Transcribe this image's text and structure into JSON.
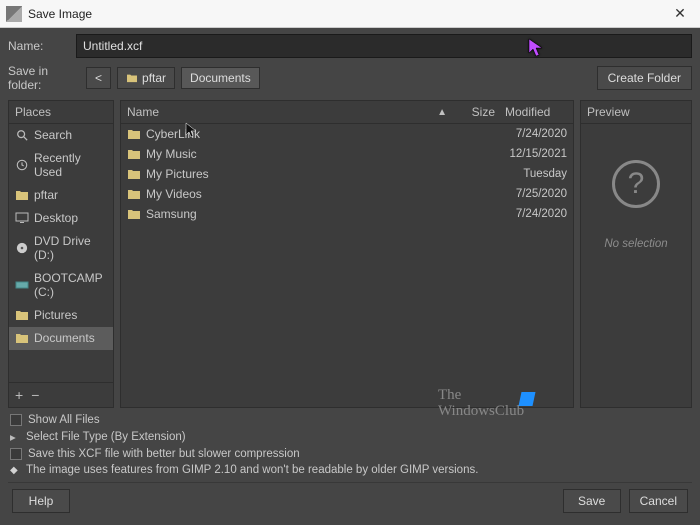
{
  "window": {
    "title": "Save Image"
  },
  "name_row": {
    "label": "Name:",
    "value": "Untitled.xcf"
  },
  "folder_row": {
    "label": "Save in folder:",
    "back": "<",
    "segments": [
      {
        "icon": "folder",
        "label": "pftar"
      },
      {
        "label": "Documents"
      }
    ],
    "create_folder": "Create Folder"
  },
  "places": {
    "header": "Places",
    "items": [
      {
        "icon": "search",
        "label": "Search"
      },
      {
        "icon": "recent",
        "label": "Recently Used"
      },
      {
        "icon": "user",
        "label": "pftar"
      },
      {
        "icon": "desktop",
        "label": "Desktop"
      },
      {
        "icon": "dvd",
        "label": "DVD Drive (D:)"
      },
      {
        "icon": "drive",
        "label": "BOOTCAMP (C:)"
      },
      {
        "icon": "folder",
        "label": "Pictures"
      },
      {
        "icon": "folder",
        "label": "Documents",
        "selected": true
      }
    ],
    "add": "+",
    "remove": "−"
  },
  "files": {
    "columns": {
      "name": "Name",
      "size": "Size",
      "modified": "Modified"
    },
    "rows": [
      {
        "name": "CyberLink",
        "modified": "7/24/2020"
      },
      {
        "name": "My Music",
        "modified": "12/15/2021"
      },
      {
        "name": "My Pictures",
        "modified": "Tuesday"
      },
      {
        "name": "My Videos",
        "modified": "7/25/2020"
      },
      {
        "name": "Samsung",
        "modified": "7/24/2020"
      }
    ]
  },
  "preview": {
    "header": "Preview",
    "empty": "No selection"
  },
  "options": {
    "show_all": "Show All Files",
    "filetype": "Select File Type (By Extension)",
    "compress": "Save this XCF file with better but slower compression",
    "compat": "The image uses features from GIMP 2.10 and won't be readable by older GIMP versions."
  },
  "buttons": {
    "help": "Help",
    "save": "Save",
    "cancel": "Cancel"
  },
  "watermark": {
    "line1": "The",
    "line2": "WindowsClub"
  }
}
